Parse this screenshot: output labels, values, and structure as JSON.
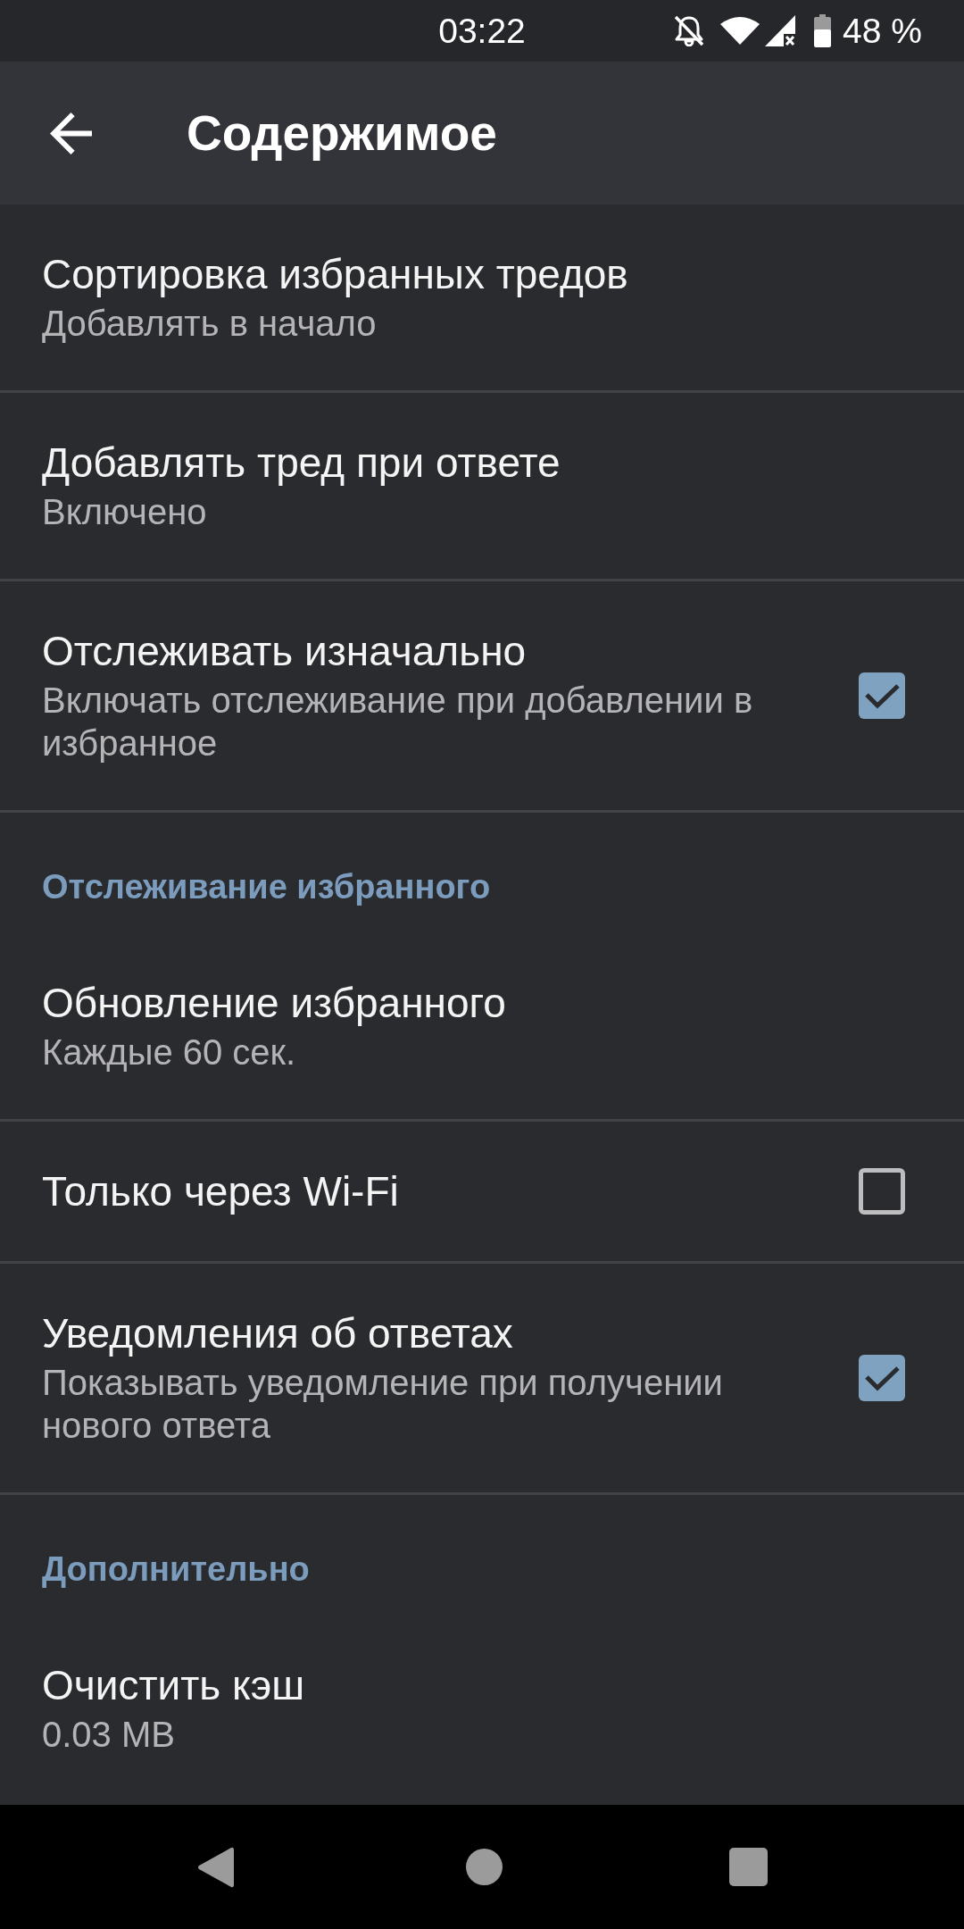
{
  "status_bar": {
    "time": "03:22",
    "battery_text": "48 %"
  },
  "toolbar": {
    "title": "Содержимое"
  },
  "sections": [
    {
      "items": [
        {
          "kind": "text",
          "title": "Сортировка избранных тредов",
          "summary": "Добавлять в начало"
        },
        {
          "kind": "text",
          "title": "Добавлять тред при ответе",
          "summary": "Включено"
        },
        {
          "kind": "checkbox",
          "title": "Отслеживать изначально",
          "summary": "Включать отслеживание при добавлении в избранное",
          "checked": true
        }
      ]
    },
    {
      "header": "Отслеживание избранного",
      "items": [
        {
          "kind": "text",
          "title": "Обновление избранного",
          "summary": "Каждые 60 сек."
        },
        {
          "kind": "checkbox",
          "title": "Только через Wi-Fi",
          "checked": false
        },
        {
          "kind": "checkbox",
          "title": "Уведомления об ответах",
          "summary": "Показывать уведомление при получении нового ответа",
          "checked": true
        }
      ]
    },
    {
      "header": "Дополнительно",
      "items": [
        {
          "kind": "text",
          "title": "Очистить кэш",
          "summary": "0.03 MB"
        }
      ]
    }
  ]
}
